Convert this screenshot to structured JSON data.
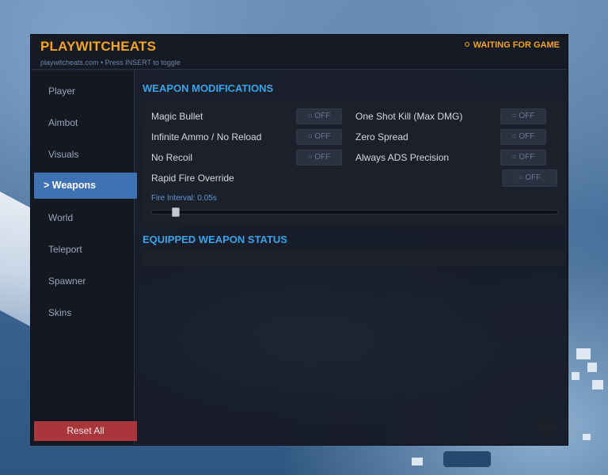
{
  "app": {
    "title": "PLAYWITCHEATS",
    "subtitle": "playwitcheats.com • Press INSERT to toggle",
    "status": "WAITING FOR GAME"
  },
  "colors": {
    "accent": "#f2a51d",
    "section_title": "#36a4e8",
    "active_nav": "#3f72b3",
    "reset": "#a9363b"
  },
  "sidebar": {
    "items": [
      {
        "label": "Player"
      },
      {
        "label": "Aimbot"
      },
      {
        "label": "Visuals"
      },
      {
        "label": "> Weapons",
        "active": true
      },
      {
        "label": "World"
      },
      {
        "label": "Teleport"
      },
      {
        "label": "Spawner"
      },
      {
        "label": "Skins"
      }
    ],
    "reset_label": "Reset All"
  },
  "weapon_mods": {
    "title": "WEAPON MODIFICATIONS",
    "options": [
      {
        "label": "Magic Bullet",
        "state": "○ OFF"
      },
      {
        "label": "One Shot Kill (Max DMG)",
        "state": "○ OFF"
      },
      {
        "label": "Infinite Ammo / No Reload",
        "state": "○ OFF"
      },
      {
        "label": "Zero Spread",
        "state": "○ OFF"
      },
      {
        "label": "No Recoil",
        "state": "○ OFF"
      },
      {
        "label": "Always ADS Precision",
        "state": "○ OFF"
      },
      {
        "label": "Rapid Fire Override",
        "state": "○ OFF"
      }
    ],
    "fire_interval_label": "Fire Interval: 0.05s",
    "fire_interval_fraction": 0.05
  },
  "equipped_status": {
    "title": "EQUIPPED WEAPON STATUS"
  }
}
